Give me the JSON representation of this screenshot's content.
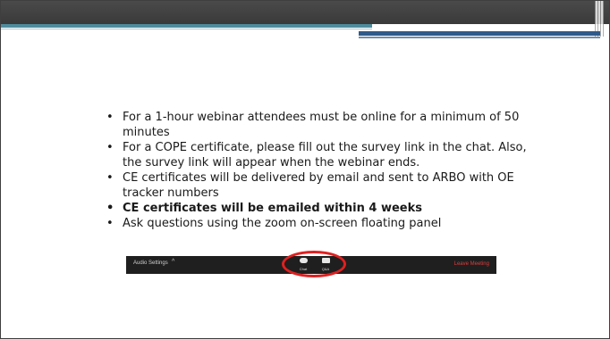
{
  "bullets": [
    {
      "text": "For a 1-hour webinar attendees must be online for a minimum of 50 minutes",
      "bold": false
    },
    {
      "text": "For a COPE certificate, please fill out the survey link in the chat. Also, the survey link will appear when the webinar ends.",
      "bold": false
    },
    {
      "text": "CE certificates will be delivered by email and sent to ARBO with OE tracker numbers",
      "bold": false
    },
    {
      "text": "CE certificates will be emailed within 4 weeks",
      "bold": true
    },
    {
      "text": "Ask questions using the zoom on-screen floating panel",
      "bold": false
    }
  ],
  "zoom_bar": {
    "audio_label": "Audio Settings",
    "chat_label": "Chat",
    "qa_label": "Q&A",
    "leave_label": "Leave Meeting",
    "icons": [
      "chevron-up-icon",
      "chat-icon",
      "qa-icon"
    ]
  },
  "colors": {
    "header": "#3a3a3a",
    "accent_teal": "#4f8c9c",
    "accent_blue": "#2f5a8a",
    "highlight": "#e02020",
    "leave": "#e23b3b"
  }
}
